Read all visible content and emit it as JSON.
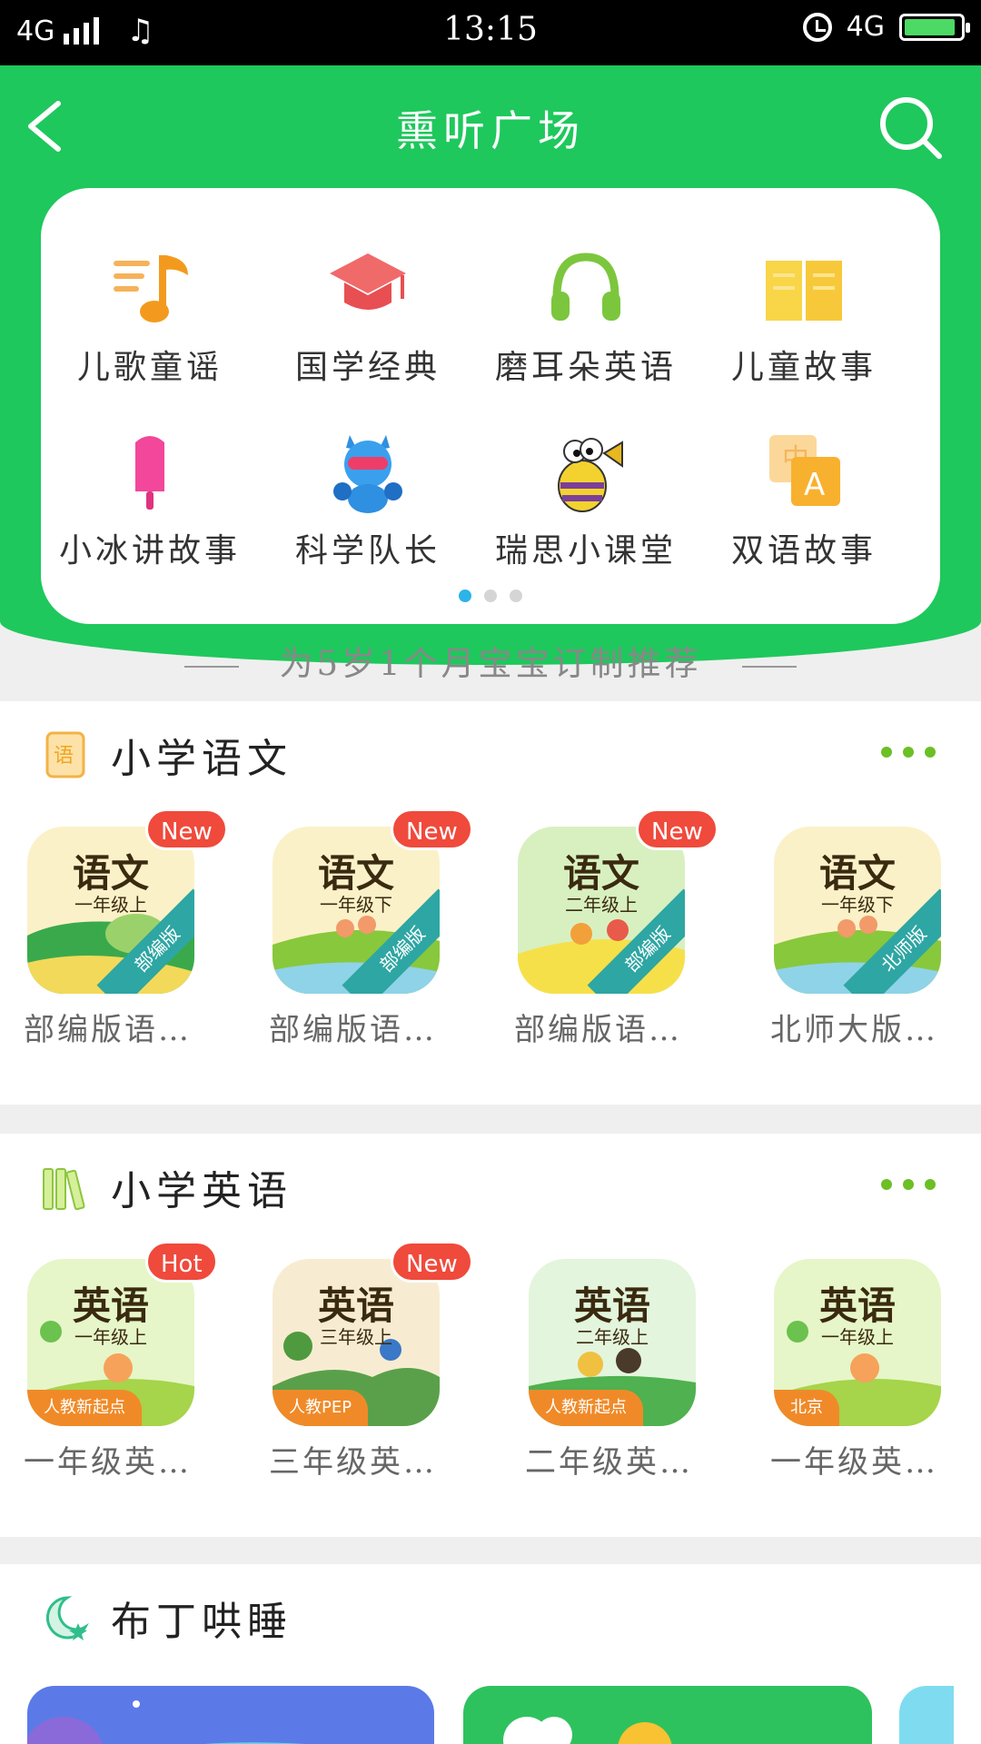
{
  "status_bar": {
    "network": "4G",
    "time": "13:15",
    "network_right": "4G",
    "icons": [
      "signal-icon",
      "music-note-icon",
      "alarm-icon",
      "battery-charging-icon"
    ]
  },
  "header": {
    "title": "熏听广场",
    "back_icon": "chevron-left-icon",
    "search_icon": "search-icon",
    "background": "#1ec85c"
  },
  "categories": [
    {
      "label": "儿歌童谣",
      "icon": "music-note-icon"
    },
    {
      "label": "国学经典",
      "icon": "graduation-cap-icon"
    },
    {
      "label": "磨耳朵英语",
      "icon": "headphones-icon"
    },
    {
      "label": "儿童故事",
      "icon": "open-book-icon"
    },
    {
      "label": "小冰讲故事",
      "icon": "popsicle-icon"
    },
    {
      "label": "科学队长",
      "icon": "robot-mascot-icon"
    },
    {
      "label": "瑞思小课堂",
      "icon": "bee-mascot-icon"
    },
    {
      "label": "双语故事",
      "icon": "bilingual-icon"
    }
  ],
  "carousel": {
    "pages": 3,
    "active": 1
  },
  "recommend_text": "为5岁1个月宝宝订制推荐",
  "sections": [
    {
      "title": "小学语文",
      "icon": "chinese-book-icon",
      "books": [
        {
          "cover_title": "语文",
          "cover_sub": "一年级上",
          "ribbon": "部编版",
          "badge": "New",
          "label": "部编版语•••"
        },
        {
          "cover_title": "语文",
          "cover_sub": "一年级下",
          "ribbon": "部编版",
          "badge": "New",
          "label": "部编版语•••"
        },
        {
          "cover_title": "语文",
          "cover_sub": "二年级上",
          "ribbon": "部编版",
          "badge": "New",
          "label": "部编版语•••"
        },
        {
          "cover_title": "语文",
          "cover_sub": "一年级下",
          "ribbon": "北师版",
          "badge": "",
          "label": "北师大版•••"
        }
      ]
    },
    {
      "title": "小学英语",
      "icon": "books-shelf-icon",
      "books": [
        {
          "cover_title": "英语",
          "cover_sub": "一年级上",
          "tag": "人教新起点",
          "badge": "Hot",
          "label": "一年级英•••"
        },
        {
          "cover_title": "英语",
          "cover_sub": "三年级上",
          "tag": "人教PEP",
          "badge": "New",
          "label": "三年级英•••"
        },
        {
          "cover_title": "英语",
          "cover_sub": "二年级上",
          "tag": "人教新起点",
          "badge": "",
          "label": "二年级英•••"
        },
        {
          "cover_title": "英语",
          "cover_sub": "一年级上",
          "tag": "北京",
          "badge": "",
          "label": "一年级英•••"
        }
      ]
    },
    {
      "title": "布丁哄睡",
      "icon": "moon-stars-icon"
    }
  ],
  "colors": {
    "accent_green": "#1ec85c",
    "more_dots": "#6cbf24",
    "badge_red": "#ef4a3c",
    "dot_active": "#2cb3e8"
  }
}
